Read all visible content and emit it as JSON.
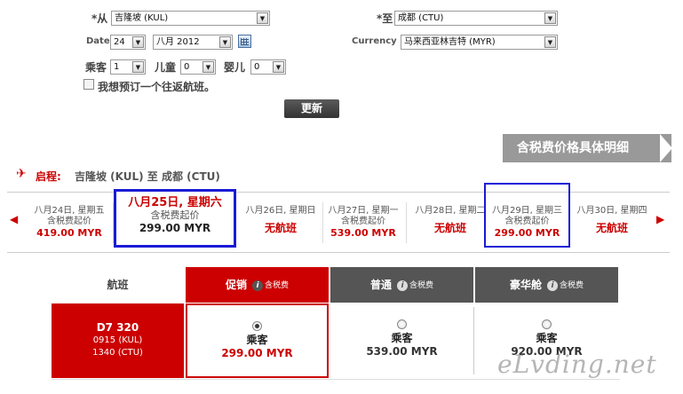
{
  "search": {
    "from_label": "*从",
    "from_value": "吉隆坡 (KUL)",
    "to_label": "*至",
    "to_value": "成都 (CTU)",
    "date_label": "Date",
    "date_day": "24",
    "date_month": "八月 2012",
    "currency_label": "Currency",
    "currency_value": "马来西亚林吉特 (MYR)",
    "adult_label": "乘客",
    "adult_value": "1",
    "child_label": "儿童",
    "child_value": "0",
    "infant_label": "婴儿",
    "infant_value": "0",
    "return_label": "我想预订一个往返航班。",
    "update_button": "更新"
  },
  "banner": {
    "label": "含税费价格具体明细"
  },
  "route": {
    "label": "启程:",
    "text": "吉隆坡 (KUL) 至 成都 (CTU)"
  },
  "days": [
    {
      "date": "八月24日, 星期五",
      "sub": "含税费起价",
      "price": "419.00 MYR",
      "selected": false
    },
    {
      "date": "八月25日, 星期六",
      "sub": "含税费起价",
      "price": "299.00 MYR",
      "selected": true
    },
    {
      "date": "八月26日, 星期日",
      "sub": "",
      "price": "无航班",
      "selected": false
    },
    {
      "date": "八月27日, 星期一",
      "sub": "含税费起价",
      "price": "539.00 MYR",
      "selected": false
    },
    {
      "date": "八月28日, 星期二",
      "sub": "",
      "price": "无航班",
      "selected": false
    },
    {
      "date": "八月29日, 星期三",
      "sub": "含税费起价",
      "price": "299.00 MYR",
      "selected": false
    },
    {
      "date": "八月30日, 星期四",
      "sub": "",
      "price": "无航班",
      "selected": false
    }
  ],
  "table": {
    "flight_header": "航班",
    "fares": [
      {
        "name": "促销",
        "tax": "含税费",
        "color": "#cc0000"
      },
      {
        "name": "普通",
        "tax": "含税费",
        "color": "#555555"
      },
      {
        "name": "豪华舱",
        "tax": "含税费",
        "color": "#555555"
      }
    ],
    "flight": {
      "number": "D7  320",
      "dep": "0915  (KUL)",
      "arr": "1340  (CTU)"
    },
    "cells": [
      {
        "label": "乘客",
        "price": "299.00 MYR",
        "selected": true
      },
      {
        "label": "乘客",
        "price": "539.00 MYR",
        "selected": false
      },
      {
        "label": "乘客",
        "price": "920.00 MYR",
        "selected": false
      }
    ]
  },
  "watermark": "eLvding.net"
}
